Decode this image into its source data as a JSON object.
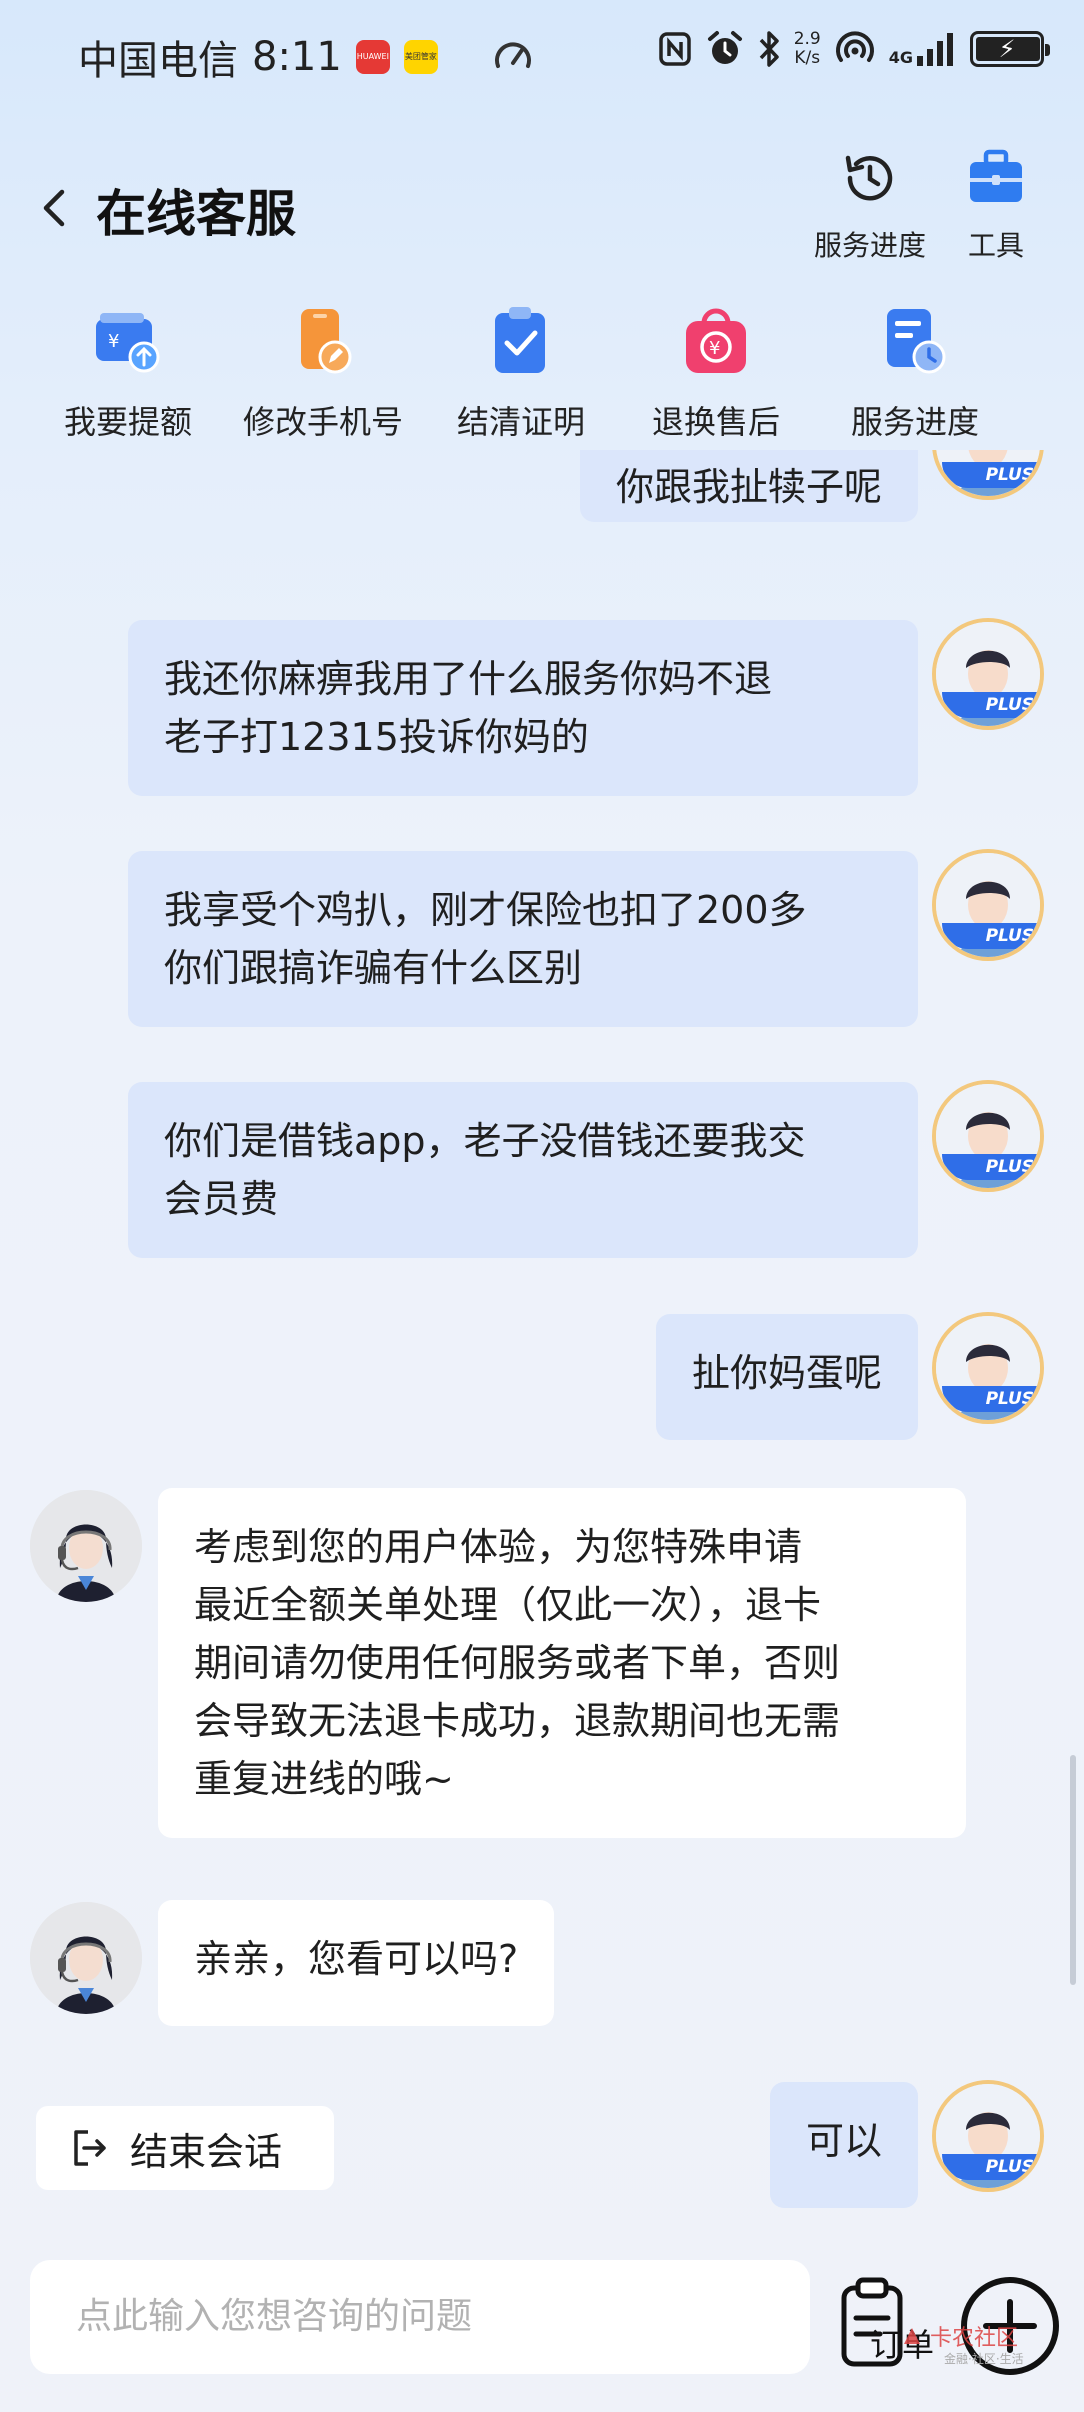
{
  "status_bar": {
    "carrier": "中国电信",
    "time": "8:11",
    "app_badge_1": "HUAWEI",
    "app_badge_2": "美团管家",
    "net_speed_value": "2.9",
    "net_speed_unit": "K/s",
    "signal_label": "4G"
  },
  "header": {
    "title": "在线客服",
    "service_progress_label": "服务进度",
    "tools_label": "工具"
  },
  "shortcuts": [
    {
      "label": "我要提额",
      "icon": "wallet-upgrade-icon",
      "color": "#3a7bf0"
    },
    {
      "label": "修改手机号",
      "icon": "phone-edit-icon",
      "color": "#f5953a"
    },
    {
      "label": "结清证明",
      "icon": "clipboard-check-icon",
      "color": "#3a7bf0"
    },
    {
      "label": "退换售后",
      "icon": "refund-bag-icon",
      "color": "#f0406e"
    },
    {
      "label": "服务进度",
      "icon": "doc-clock-icon",
      "color": "#3a7bf0"
    }
  ],
  "messages": [
    {
      "from": "user",
      "text": "你跟我扯犊子呢"
    },
    {
      "from": "user",
      "line1": "我还你麻痹我用了什么服务你妈不退",
      "line2": "老子打12315投诉你妈的"
    },
    {
      "from": "user",
      "line1": "我享受个鸡扒，刚才保险也扣了200多",
      "line2": "你们跟搞诈骗有什么区别"
    },
    {
      "from": "user",
      "line1": "你们是借钱app，老子没借钱还要我交",
      "line2": "会员费"
    },
    {
      "from": "user",
      "text": "扯你妈蛋呢"
    },
    {
      "from": "agent",
      "line1": "考虑到您的用户体验，为您特殊申请",
      "line2": "最近全额关单处理（仅此一次），退卡",
      "line3": "期间请勿使用任何服务或者下单，否则",
      "line4": "会导致无法退卡成功，退款期间也无需",
      "line5": "重复进线的哦~"
    },
    {
      "from": "agent",
      "text": "亲亲，您看可以吗?"
    },
    {
      "from": "user",
      "text": "可以"
    }
  ],
  "user_avatar_tag": "PLUS",
  "end_chat_label": "结束会话",
  "input": {
    "placeholder": "点此输入您想咨询的问题",
    "order_label": "订单"
  },
  "watermark": {
    "text": "卡农社区",
    "sub": "金融·社区·生活"
  },
  "colors": {
    "accent": "#2f6ee8",
    "user_bubble": "#dbe6fb",
    "agent_bubble": "#ffffff"
  }
}
